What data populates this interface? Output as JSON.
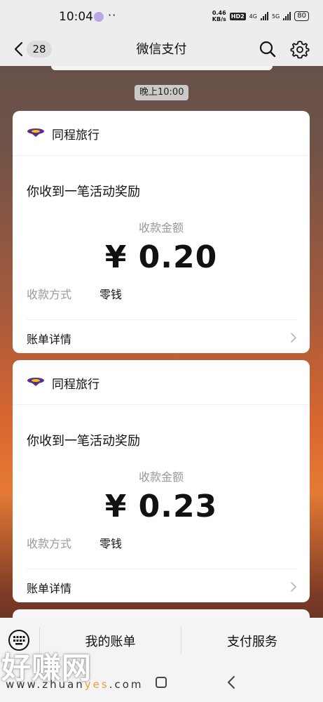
{
  "status_bar": {
    "time": "10:04",
    "dots": "··",
    "net_speed_value": "0.46",
    "net_speed_unit": "KB/s",
    "hd": "HD2",
    "network_1": "4G",
    "network_2": "5G",
    "battery": "80"
  },
  "nav": {
    "unread_count": "28",
    "title": "微信支付"
  },
  "messages": [
    {
      "time": "晚上10:00"
    }
  ],
  "cards": [
    {
      "merchant": "同程旅行",
      "headline": "你收到一笔活动奖励",
      "amount_label": "收款金额",
      "amount": "¥ 0.20",
      "method_label": "收款方式",
      "method_value": "零钱",
      "details_label": "账单详情"
    },
    {
      "merchant": "同程旅行",
      "headline": "你收到一笔活动奖励",
      "amount_label": "收款金额",
      "amount": "¥ 0.23",
      "method_label": "收款方式",
      "method_value": "零钱",
      "details_label": "账单详情"
    }
  ],
  "bottom_menu": {
    "bills": "我的账单",
    "services": "支付服务"
  },
  "watermark": {
    "logo": "好赚网",
    "url_prefix": "www.zhuan",
    "url_highlight": "yes",
    "url_suffix": ".com"
  },
  "colors": {
    "nav_background": "#ededed",
    "card_background": "#ffffff",
    "merchant_logo_purple": "#5b2d8e",
    "merchant_logo_yellow": "#f5c400",
    "watermark_highlight": "#e8a23a"
  },
  "icons": [
    "back-arrow-icon",
    "search-icon",
    "gear-icon",
    "merchant-logo",
    "chevron-right-icon",
    "keyboard-icon",
    "home-icon",
    "back-icon"
  ]
}
